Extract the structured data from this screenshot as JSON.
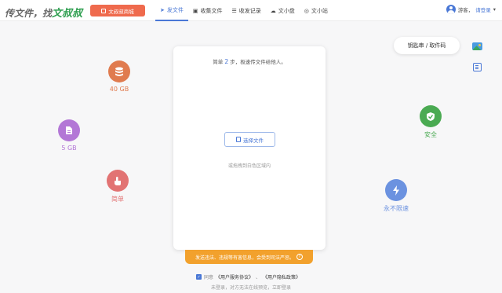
{
  "header": {
    "logo_prefix": "传文件，找",
    "logo_highlight": "文叔叔",
    "shop_label": "文叔叔商城",
    "nav": [
      {
        "label": "发文件",
        "icon": "send-icon"
      },
      {
        "label": "收集文件",
        "icon": "collect-icon"
      },
      {
        "label": "收发记录",
        "icon": "record-icon"
      },
      {
        "label": "文小盘",
        "icon": "cloud-icon"
      },
      {
        "label": "文小站",
        "icon": "compass-icon"
      }
    ],
    "user_guest": "游客，",
    "user_login": "请登录"
  },
  "features": [
    {
      "label": "40 GB",
      "icon": "database-icon",
      "color": "#e07b4f"
    },
    {
      "label": "5 GB",
      "icon": "document-icon",
      "color": "#b377d6"
    },
    {
      "label": "简单",
      "icon": "touch-icon",
      "color": "#e27373"
    },
    {
      "label": "安全",
      "icon": "shield-check-icon",
      "color": "#4aaa52"
    },
    {
      "label": "永不限速",
      "icon": "lightning-icon",
      "color": "#6b92e0"
    }
  ],
  "card": {
    "steps_pre": "简单",
    "steps_num": "2",
    "steps_post": "步，极速传文件给他人。",
    "choose_label": "选择文件",
    "drop_hint": "或拖拽到白色区域内"
  },
  "warning": {
    "text": "发送违法、违规等有害信息，会受到司法严惩。",
    "help": "?"
  },
  "agreement": {
    "agree_label": "同意",
    "user_agreement": "《用户服务协议》",
    "sep": "、",
    "privacy": "《用户隐私政策》",
    "note": "未登录，对方无法在线预览，立即登录"
  },
  "side": {
    "key_button": "钥匙串 / 取件码"
  },
  "colors": {
    "accent": "#4a78d6",
    "shop": "#ef6a4d",
    "warning": "#f2a12d"
  }
}
